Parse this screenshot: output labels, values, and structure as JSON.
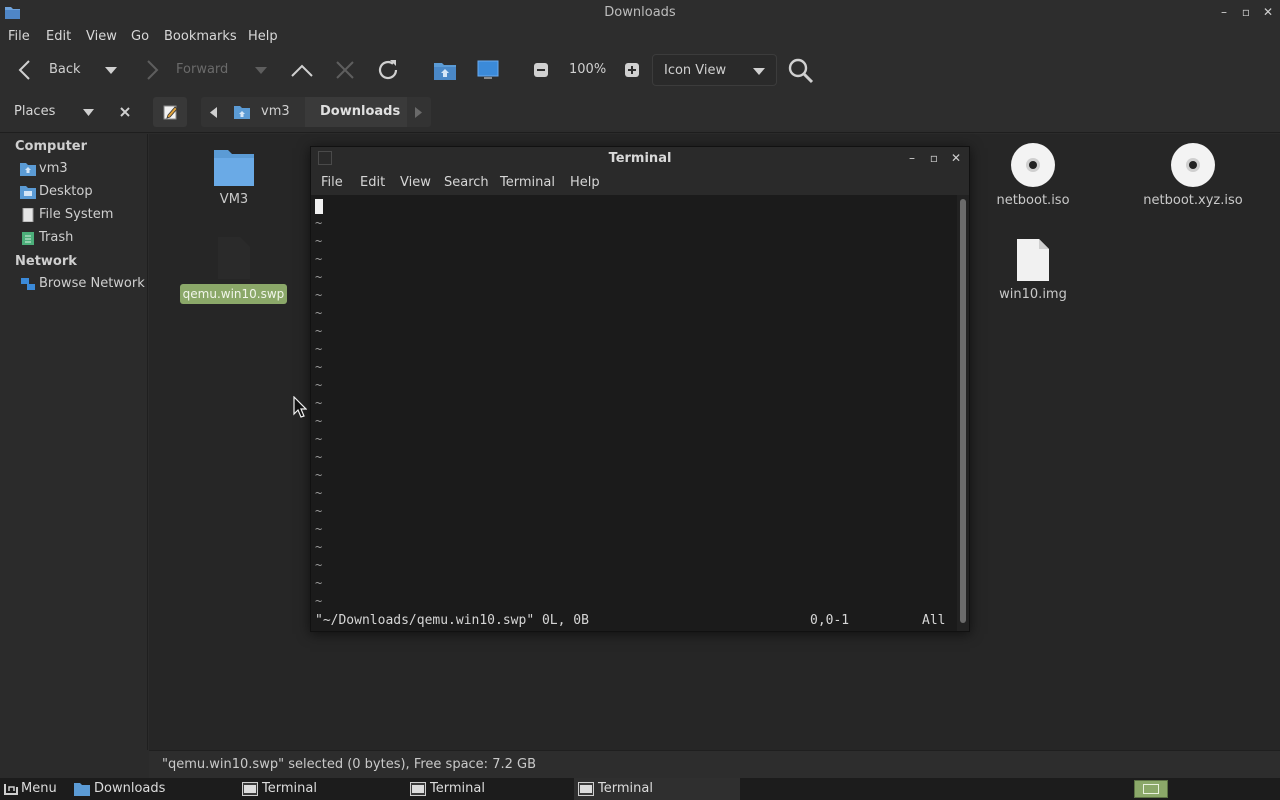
{
  "window": {
    "title": "Downloads",
    "minimize": "–",
    "maximize": "▫",
    "close": "✕"
  },
  "menubar": [
    "File",
    "Edit",
    "View",
    "Go",
    "Bookmarks",
    "Help"
  ],
  "toolbar": {
    "back_label": "Back",
    "forward_label": "Forward",
    "zoom_level": "100%",
    "view_mode": "Icon View"
  },
  "location": {
    "places_label": "Places",
    "breadcrumbs": [
      "vm3",
      "Downloads"
    ]
  },
  "sidebar": {
    "sections": [
      {
        "title": "Computer",
        "items": [
          {
            "label": "vm3",
            "icon": "home-folder-icon"
          },
          {
            "label": "Desktop",
            "icon": "desktop-folder-icon"
          },
          {
            "label": "File System",
            "icon": "drive-icon"
          },
          {
            "label": "Trash",
            "icon": "trash-icon"
          }
        ]
      },
      {
        "title": "Network",
        "items": [
          {
            "label": "Browse Network",
            "icon": "network-icon"
          }
        ]
      }
    ]
  },
  "files": [
    {
      "name": "VM3",
      "icon": "folder-icon"
    },
    {
      "name": "qemu.win10.swp",
      "icon": "file-icon",
      "selected": true
    },
    {
      "name": "netboot.iso",
      "icon": "disc-icon"
    },
    {
      "name": "netboot.xyz.iso",
      "icon": "disc-icon"
    },
    {
      "name": "win10.img",
      "icon": "file-icon"
    }
  ],
  "statusbar": {
    "text": "\"qemu.win10.swp\" selected (0 bytes), Free space: 7.2 GB"
  },
  "terminal": {
    "title": "Terminal",
    "menu": [
      "File",
      "Edit",
      "View",
      "Search",
      "Terminal",
      "Help"
    ],
    "tilde": "~",
    "vim_status": "\"~/Downloads/qemu.win10.swp\" 0L, 0B",
    "vim_position": "0,0-1",
    "vim_scroll": "All"
  },
  "taskbar": {
    "menu_label": "Menu",
    "tasks": [
      "Downloads",
      "Terminal",
      "Terminal",
      "Terminal"
    ]
  },
  "colors": {
    "selection": "#8ba869",
    "folder": "#5b9bd5"
  }
}
